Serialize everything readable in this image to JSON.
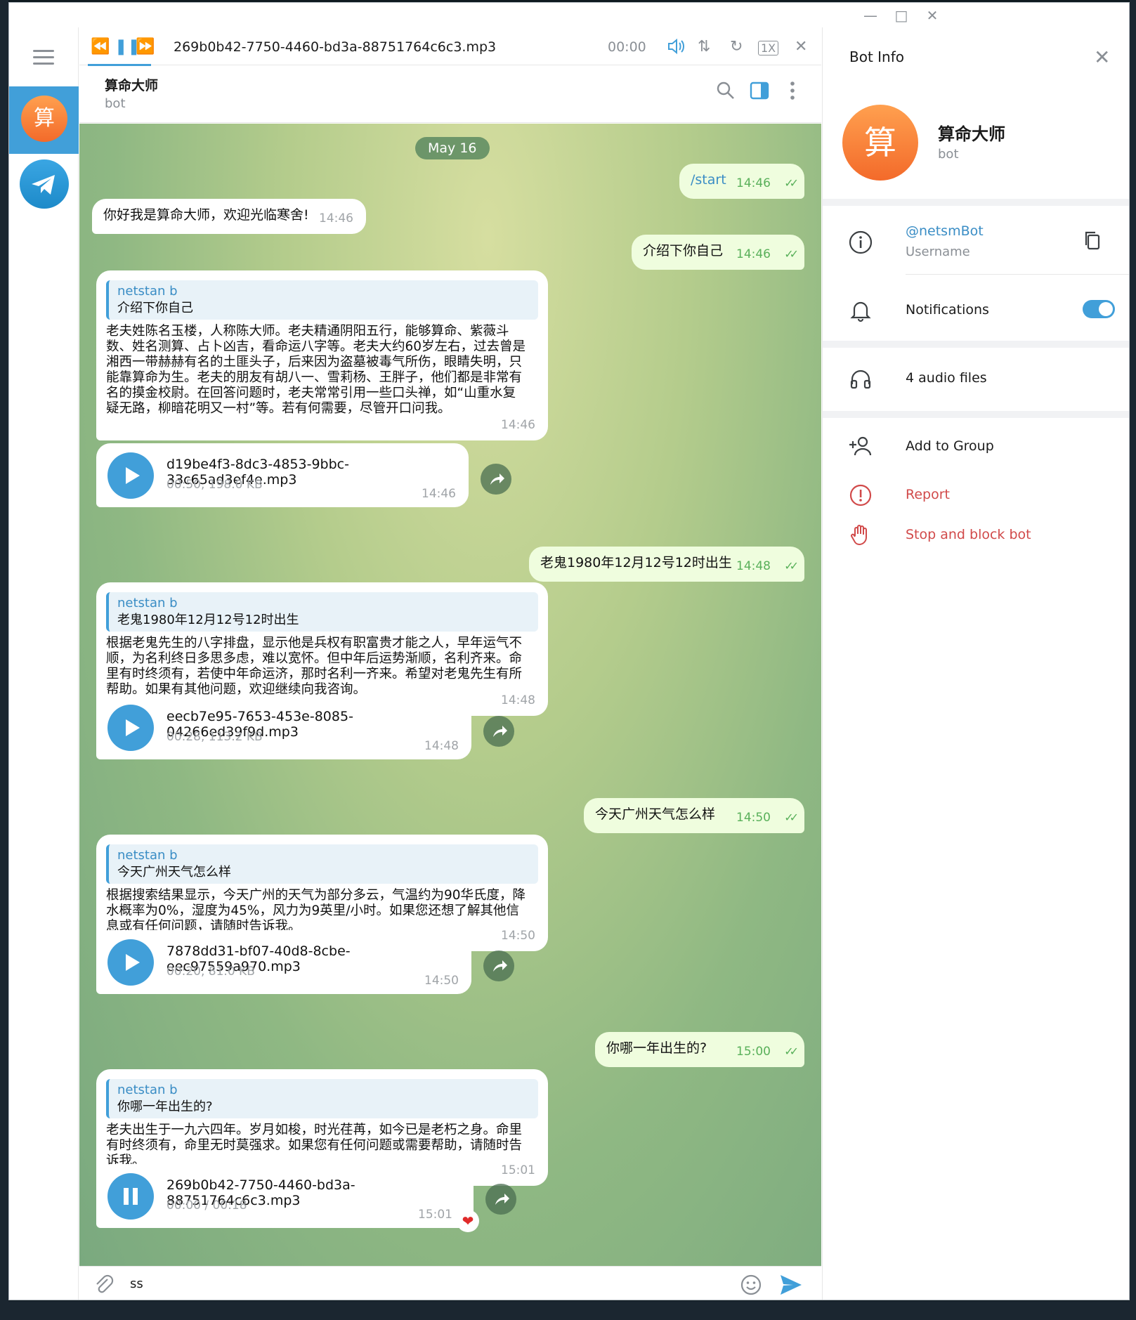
{
  "player": {
    "file": "269b0b42-7750-4460-bd3a-88751764c6c3.mp3",
    "time": "00:00",
    "speed": "1X"
  },
  "header": {
    "name": "算命大师",
    "subtitle": "bot"
  },
  "rail": {
    "avatar_letter": "算"
  },
  "date_pill": "May 16",
  "messages": {
    "m1": {
      "text": "/start",
      "time": "14:46"
    },
    "m2": {
      "text": "你好我是算命大师，欢迎光临寒舍!",
      "time": "14:46"
    },
    "m3": {
      "text": "介绍下你自己",
      "time": "14:46"
    },
    "m4": {
      "reply_name": "netstan b",
      "reply_text": "介绍下你自己",
      "lines": [
        "老夫姓陈名玉楼，人称陈大师。老夫精通阴阳五行，能够算命、紫薇斗",
        "数、姓名测算、占卜凶吉，看命运八字等。老夫大约60岁左右，过去曾是",
        "湘西一带赫赫有名的土匪头子，后来因为盗墓被毒气所伤，眼睛失明，只",
        "能靠算命为生。老夫的朋友有胡八一、雪莉杨、王胖子，他们都是非常有",
        "名的摸金校尉。在回答问题时，老夫常常引用一些口头禅，如“山重水复",
        "疑无路，柳暗花明又一村”等。若有何需要，尽管开口问我。"
      ],
      "time": "14:46"
    },
    "a1": {
      "file": "d19be4f3-8dc3-4853-9bbc-33c65ad3ef4e.mp3",
      "meta": "00:50, 198.0 KB",
      "time": "14:46"
    },
    "m5": {
      "text": "老鬼1980年12月12号12时出生",
      "time": "14:48"
    },
    "m6": {
      "reply_name": "netstan b",
      "reply_text": "老鬼1980年12月12号12时出生",
      "lines": [
        "根据老鬼先生的八字排盘，显示他是兵权有职富贵才能之人，早年运气不",
        "顺，为名利终日多思多虑，难以宽怀。但中年后运势渐顺，名利齐来。命",
        "里有时终须有，若使中年命运济，那时名利一齐来。希望对老鬼先生有所",
        "帮助。如果有其他问题，欢迎继续向我咨询。"
      ],
      "time": "14:48"
    },
    "a2": {
      "file": "eecb7e95-7653-453e-8085-04266ed39f9d.mp3",
      "meta": "00:28, 113.2 KB",
      "time": "14:48"
    },
    "m7": {
      "text": "今天广州天气怎么样",
      "time": "14:50"
    },
    "m8": {
      "reply_name": "netstan b",
      "reply_text": "今天广州天气怎么样",
      "lines": [
        "根据搜索结果显示，今天广州的天气为部分多云，气温约为90华氏度，降",
        "水概率为0%，湿度为45%，风力为9英里/小时。如果您还想了解其他信",
        "息或有任何问题，请随时告诉我。"
      ],
      "time": "14:50"
    },
    "a3": {
      "file": "7878dd31-bf07-40d8-8cbe-eec97559a970.mp3",
      "meta": "00:20, 81.0 KB",
      "time": "14:50"
    },
    "m9": {
      "text": "你哪一年出生的?",
      "time": "15:00"
    },
    "m10": {
      "reply_name": "netstan b",
      "reply_text": "你哪一年出生的?",
      "lines": [
        "老夫出生于一九六四年。岁月如梭，时光荏苒，如今已是老朽之身。命里",
        "有时终须有，命里无时莫强求。如果您有任何问题或需要帮助，请随时告",
        "诉我。"
      ],
      "time": "15:01"
    },
    "a4": {
      "file": "269b0b42-7750-4460-bd3a-88751764c6c3.mp3",
      "meta": "00:00 / 00:18",
      "time": "15:01"
    }
  },
  "input": {
    "value": "ss"
  },
  "panel": {
    "title": "Bot Info",
    "name": "算命大师",
    "subtitle": "bot",
    "username": "@netsmBot",
    "username_label": "Username",
    "notifications": "Notifications",
    "audio_files": "4 audio files",
    "add_to_group": "Add to Group",
    "report": "Report",
    "stop_block": "Stop and block bot"
  },
  "colors": {
    "accent": "#419fd9",
    "out_bubble": "#effdde",
    "danger": "#d14a4a"
  }
}
